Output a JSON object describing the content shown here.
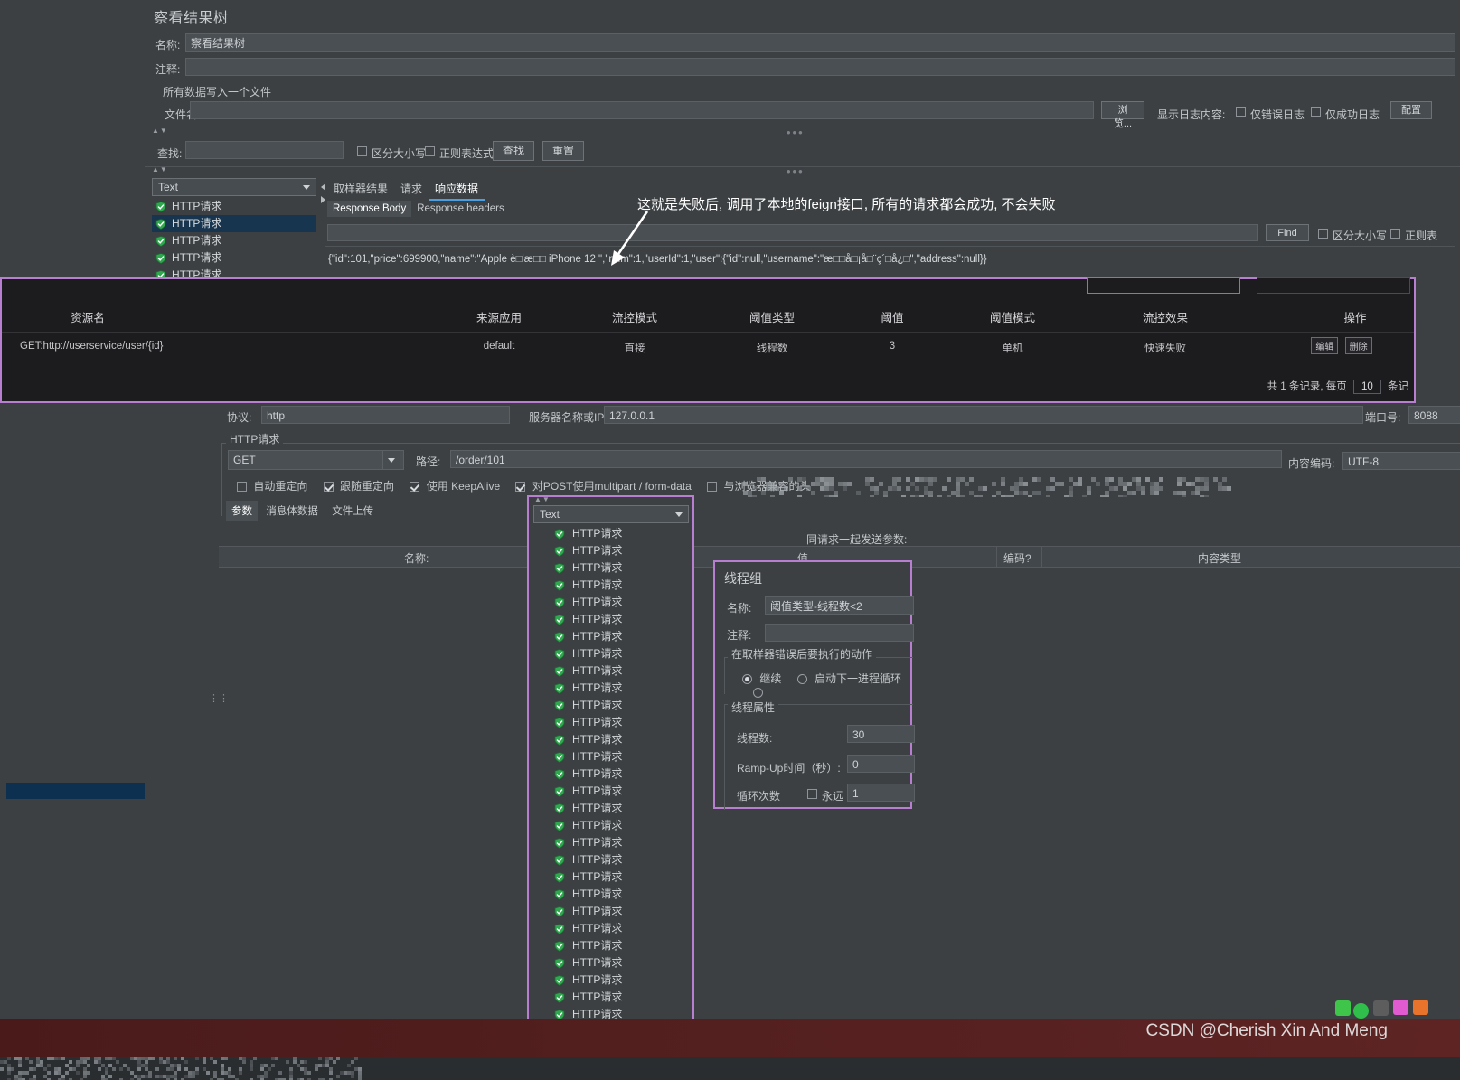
{
  "app": {
    "panel_title": "察看结果树",
    "name_label": "名称:",
    "name_value": "察看结果树",
    "comment_label": "注释:",
    "comment_value": "",
    "file_group_label": "所有数据写入一个文件",
    "filename_label": "文件名",
    "filename_value": "",
    "browse_button": "浏览...",
    "log_display_label": "显示日志内容:",
    "errors_only_label": "仅错误日志",
    "success_only_label": "仅成功日志",
    "config_button": "配置",
    "search_label": "查找:",
    "search_value": "",
    "case_sensitive_label": "区分大小写",
    "regex_label": "正则表达式",
    "find_button": "查找",
    "reset_button": "重置"
  },
  "results_tree": {
    "renderer_value": "Text",
    "items": [
      {
        "label": "HTTP请求",
        "selected": false
      },
      {
        "label": "HTTP请求",
        "selected": true
      },
      {
        "label": "HTTP请求",
        "selected": false
      },
      {
        "label": "HTTP请求",
        "selected": false
      },
      {
        "label": "HTTP请求",
        "selected": false
      }
    ]
  },
  "result_tabs": {
    "tabs": [
      {
        "label": "取样器结果",
        "active": false
      },
      {
        "label": "请求",
        "active": false
      },
      {
        "label": "响应数据",
        "active": true
      }
    ],
    "subtabs": [
      {
        "label": "Response Body",
        "active": true
      },
      {
        "label": "Response headers",
        "active": false
      }
    ],
    "find_field_value": "",
    "find_button": "Find",
    "case_sensitive_label": "区分大小写",
    "regex_label": "正则表",
    "response_body": "{\"id\":101,\"price\":699900,\"name\":\"Apple è□'æ□□ iPhone 12 \",\"num\":1,\"userId\":1,\"user\":{\"id\":null,\"username\":\"æ□□å□¡å□¨ç´□å¿□\",\"address\":null}}"
  },
  "annotation": {
    "text": "这就是失败后, 调用了本地的feign接口, 所有的请求都会成功, 不会失败"
  },
  "sentinel": {
    "columns": [
      "资源名",
      "来源应用",
      "流控模式",
      "阈值类型",
      "阈值",
      "阈值模式",
      "流控效果",
      "操作"
    ],
    "row": {
      "resource": "GET:http://userservice/user/{id}",
      "origin_app": "default",
      "flow_mode": "直接",
      "threshold_type": "线程数",
      "threshold": "3",
      "threshold_mode": "单机",
      "flow_effect": "快速失败"
    },
    "edit_button": "编辑",
    "delete_button": "删除",
    "footer_prefix": "共 1 条记录, 每页",
    "page_size": "10",
    "footer_suffix": "条记"
  },
  "sampler": {
    "protocol_label": "协议:",
    "protocol_value": "http",
    "server_label": "服务器名称或IP:",
    "server_value": "127.0.0.1",
    "port_label": "端口号:",
    "port_value": "8088",
    "group_label": "HTTP请求",
    "method_value": "GET",
    "path_label": "路径:",
    "path_value": "/order/101",
    "encoding_label": "内容编码:",
    "encoding_value": "UTF-8",
    "checkboxes": [
      {
        "label": "自动重定向",
        "checked": false
      },
      {
        "label": "跟随重定向",
        "checked": true
      },
      {
        "label": "使用 KeepAlive",
        "checked": true
      },
      {
        "label": "对POST使用multipart / form-data",
        "checked": true
      },
      {
        "label": "与浏览器兼容的头",
        "checked": false
      }
    ],
    "tabs": [
      {
        "label": "参数",
        "active": true
      },
      {
        "label": "消息体数据",
        "active": false
      },
      {
        "label": "文件上传",
        "active": false
      }
    ],
    "params_caption": "同请求一起发送参数:",
    "param_columns": [
      "名称:",
      "值",
      "编码?",
      "内容类型"
    ]
  },
  "popup_tree": {
    "renderer_value": "Text",
    "item_label": "HTTP请求",
    "item_count": 30
  },
  "thread_group": {
    "title": "线程组",
    "name_label": "名称:",
    "name_value": "阈值类型-线程数<2",
    "comment_label": "注释:",
    "comment_value": "",
    "error_action_group": "在取样器错误后要执行的动作",
    "radios": [
      {
        "label": "继续",
        "selected": true
      },
      {
        "label": "启动下一进程循环",
        "selected": false
      },
      {
        "label": "",
        "selected": false
      }
    ],
    "properties_group": "线程属性",
    "thread_count_label": "线程数:",
    "thread_count_value": "30",
    "rampup_label": "Ramp-Up时间（秒）:",
    "rampup_value": "0",
    "loop_label": "循环次数",
    "forever_label": "永远",
    "loop_value": "1"
  },
  "footer": {
    "watermark": "CSDN @Cherish Xin And Meng"
  },
  "colors": {
    "accent_purple": "#b87fd0",
    "tab_underline": "#4a9fe0",
    "selection_blue": "#17354e",
    "panel_bg": "#3c4043",
    "dark_overlay_bg": "#1c1c1e"
  }
}
